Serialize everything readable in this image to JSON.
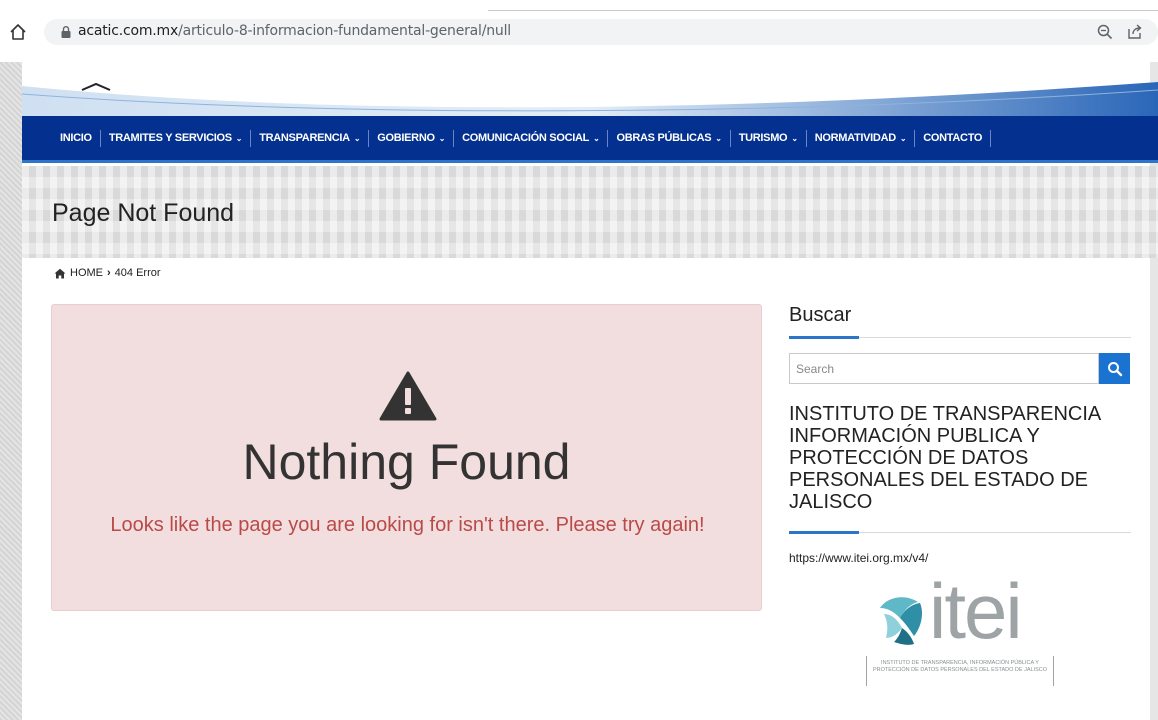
{
  "browser": {
    "url_host": "acatic.com.mx",
    "url_path": "/articulo-8-informacion-fundamental-general/null",
    "icons": [
      "home-icon",
      "lock-icon",
      "zoom-icon",
      "share-icon"
    ]
  },
  "nav": {
    "items": [
      {
        "label": "INICIO",
        "has_dropdown": false
      },
      {
        "label": "TRAMITES Y SERVICIOS",
        "has_dropdown": true
      },
      {
        "label": "TRANSPARENCIA",
        "has_dropdown": true
      },
      {
        "label": "GOBIERNO",
        "has_dropdown": true
      },
      {
        "label": "COMUNICACIÓN SOCIAL",
        "has_dropdown": true
      },
      {
        "label": "OBRAS PÚBLICAS",
        "has_dropdown": true
      },
      {
        "label": "TURISMO",
        "has_dropdown": true
      },
      {
        "label": "NORMATIVIDAD",
        "has_dropdown": true
      },
      {
        "label": "CONTACTO",
        "has_dropdown": false
      }
    ],
    "dropdown_glyph": "⌄"
  },
  "page": {
    "title": "Page Not Found",
    "breadcrumb": {
      "home": "HOME",
      "separator": "›",
      "current": "404 Error"
    }
  },
  "error": {
    "heading": "Nothing Found",
    "message": "Looks like the page you are looking for isn't there. Please try again!"
  },
  "sidebar": {
    "search_title": "Buscar",
    "search_placeholder": "Search",
    "institute_title": "INSTITUTO DE TRANSPARENCIA INFORMACIÓN PUBLICA Y PROTECCIÓN DE DATOS PERSONALES DEL ESTADO DE JALISCO",
    "institute_url": "https://www.itei.org.mx/v4/",
    "logo": {
      "word": "itei",
      "caption": "INSTITUTO DE TRANSPARENCIA, INFORMACIÓN PÚBLICA Y PROTECCIÓN DE DATOS PERSONALES DEL ESTADO DE JALISCO"
    }
  },
  "colors": {
    "nav_bg": "#04318f",
    "accent": "#2e75c9",
    "error_bg": "#f2dede",
    "error_text": "#b94a48",
    "search_btn": "#1a73d1"
  }
}
